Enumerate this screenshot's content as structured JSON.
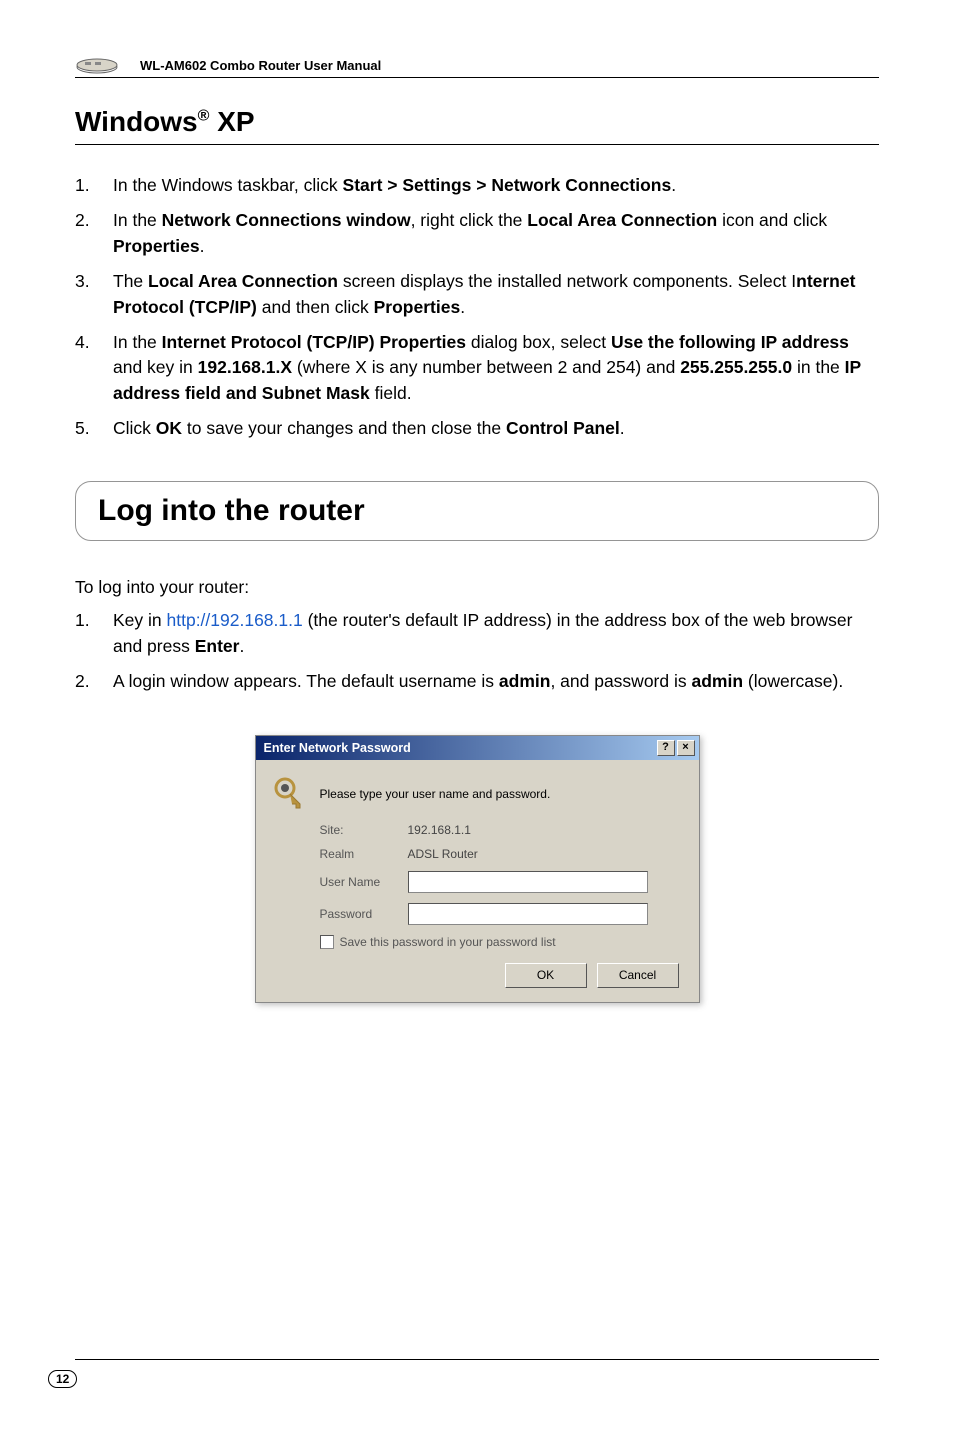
{
  "header": {
    "manual_title": "WL-AM602 Combo Router User Manual"
  },
  "section1": {
    "title_prefix": "Windows",
    "title_reg": "®",
    "title_suffix": " XP",
    "steps": [
      {
        "pre": "In the Windows taskbar, click ",
        "b1": "Start > Settings > Network Connections",
        "post": "."
      },
      {
        "pre": "In the ",
        "b1": "Network Connections window",
        "mid1": ", right click the ",
        "b2": "Local Area Connection",
        "mid2": " icon and click ",
        "b3": "Properties",
        "post": "."
      },
      {
        "pre": "The ",
        "b1": "Local Area Connection",
        "mid1": " screen displays the installed network components. Select I",
        "b2": "nternet Protocol (TCP/IP)",
        "mid2": " and then click ",
        "b3": "Properties",
        "post": "."
      },
      {
        "pre": "In the ",
        "b1": "Internet Protocol (TCP/IP) Properties",
        "mid1": " dialog box, select ",
        "b2": "Use the following IP address",
        "mid2": " and key in ",
        "b3": "192.168.1.X",
        "mid3": " (where X is any number between 2 and 254) and ",
        "b4": "255.255.255.0",
        "mid4": " in the ",
        "b5": "IP address field and Subnet Mask",
        "post": " field."
      },
      {
        "pre": "Click ",
        "b1": "OK",
        "mid1": " to save your changes and then close the ",
        "b2": "Control Panel",
        "post": "."
      }
    ]
  },
  "section2": {
    "heading": "Log into the router",
    "intro": "To log into your router:",
    "steps": [
      {
        "pre": "Key in ",
        "link": "http://192.168.1.1",
        "mid1": " (the router's default IP address) in the address box of the web browser and press ",
        "b1": "Enter",
        "post": "."
      },
      {
        "pre": "A login window appears. The default username is ",
        "b1": "admin",
        "mid1": ", and password is ",
        "b2": "admin",
        "post": " (lowercase)."
      }
    ]
  },
  "dialog": {
    "title": "Enter Network Password",
    "help_btn": "?",
    "close_btn": "×",
    "prompt": "Please type your user name and password.",
    "site_label": "Site:",
    "site_value": "192.168.1.1",
    "realm_label": "Realm",
    "realm_value": "ADSL Router",
    "user_label": "User Name",
    "pass_label": "Password",
    "checkbox_label": "Save this password in your password list",
    "ok_label": "OK",
    "cancel_label": "Cancel"
  },
  "footer": {
    "page_number": "12"
  }
}
